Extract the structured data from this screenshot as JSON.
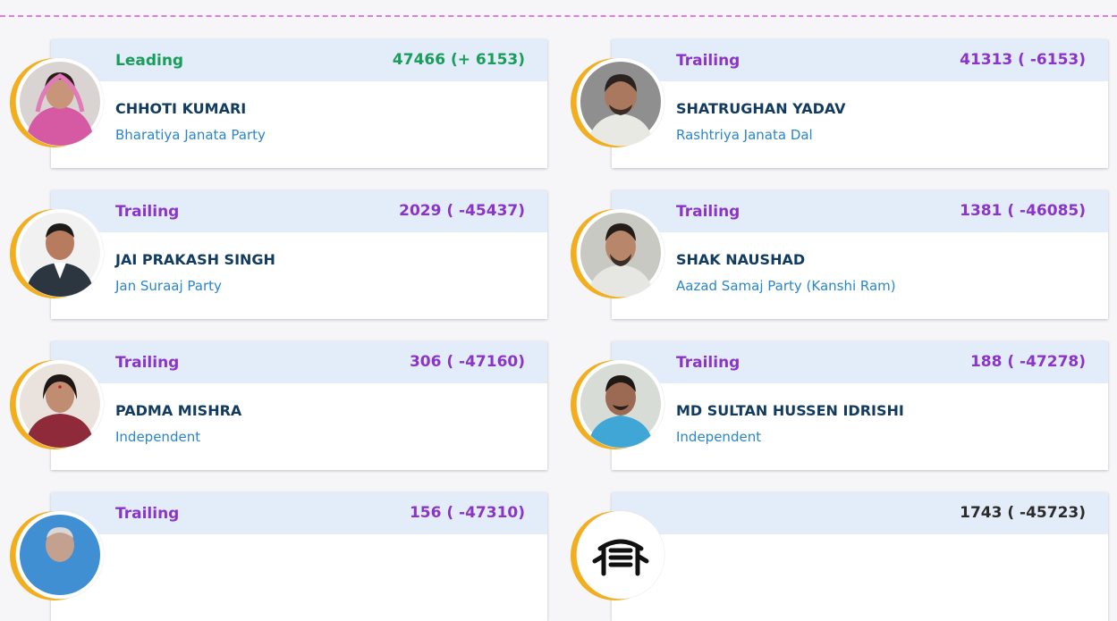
{
  "colors": {
    "leading": "#1a9d5b",
    "trailing": "#8a35c8",
    "neutral": "#2b2b2b",
    "ring": "#f2ae1c",
    "name": "#123c5f",
    "party": "#2a86c8"
  },
  "candidates": [
    {
      "status": "Leading",
      "votes": "47466 (+ 6153)",
      "name": "CHHOTI KUMARI",
      "party": "Bharatiya Janata Party"
    },
    {
      "status": "Trailing",
      "votes": "41313 ( -6153)",
      "name": "SHATRUGHAN YADAV",
      "party": "Rashtriya Janata Dal"
    },
    {
      "status": "Trailing",
      "votes": "2029 ( -45437)",
      "name": "JAI PRAKASH SINGH",
      "party": "Jan Suraaj Party"
    },
    {
      "status": "Trailing",
      "votes": "1381 ( -46085)",
      "name": "SHAK NAUSHAD",
      "party": "Aazad Samaj Party (Kanshi Ram)"
    },
    {
      "status": "Trailing",
      "votes": "306 ( -47160)",
      "name": "PADMA MISHRA",
      "party": "Independent"
    },
    {
      "status": "Trailing",
      "votes": "188 ( -47278)",
      "name": "MD SULTAN HUSSEN IDRISHI",
      "party": "Independent"
    },
    {
      "status": "Trailing",
      "votes": "156 ( -47310)",
      "name": "",
      "party": ""
    },
    {
      "status": "",
      "votes": "1743 ( -45723)",
      "name": "",
      "party": ""
    }
  ]
}
